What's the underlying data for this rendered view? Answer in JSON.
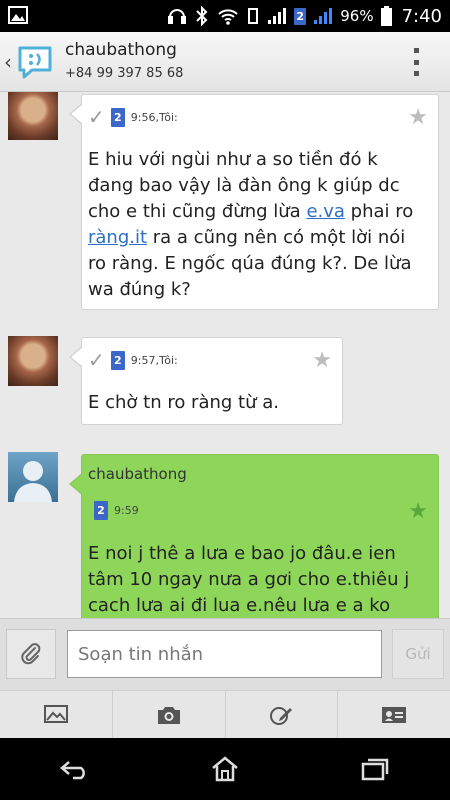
{
  "status_bar": {
    "battery": "96%",
    "time": "7:40",
    "sim_label": "2"
  },
  "header": {
    "contact_name": "chaubathong",
    "contact_phone": "+84 99 397 85 68"
  },
  "messages": [
    {
      "direction": "sent",
      "sim": "2",
      "meta": "9:56,Tôi:",
      "text_before_link1": "E hiu với ngùi như a so tiền đó k đang bao vậy là đàn ông k giúp dc cho e thi cũng đừng lừa ",
      "link1": "e.va",
      "text_between": " phai ro ",
      "link2": "ràng.it",
      "text_after": " ra a cũng nên có một lời nói ro ràng. E ngốc qúa đúng k?. De lừa wa đúng k?"
    },
    {
      "direction": "sent",
      "sim": "2",
      "meta": "9:57,Tôi:",
      "text": "E chờ tn ro ràng từ a."
    },
    {
      "direction": "received",
      "sender": "chaubathong",
      "sim": "2",
      "meta": "9:59",
      "text": "E noi j thê a lưa e bao jo đâu.e ien tâm 10 ngay nưa a gơi cho e.thiêu j cach lưa ai đi lua e.nêu lưa e a ko"
    }
  ],
  "compose": {
    "placeholder": "Soạn tin nhắn",
    "send_label": "Gửi"
  },
  "icons": {
    "attach": "paperclip-icon",
    "gallery": "image-icon",
    "camera": "camera-icon",
    "draw": "sketch-icon",
    "contact": "contact-card-icon"
  },
  "colors": {
    "received_bubble": "#8ed65a",
    "sim_badge": "#3a67c8",
    "link": "#2b6fc9"
  }
}
